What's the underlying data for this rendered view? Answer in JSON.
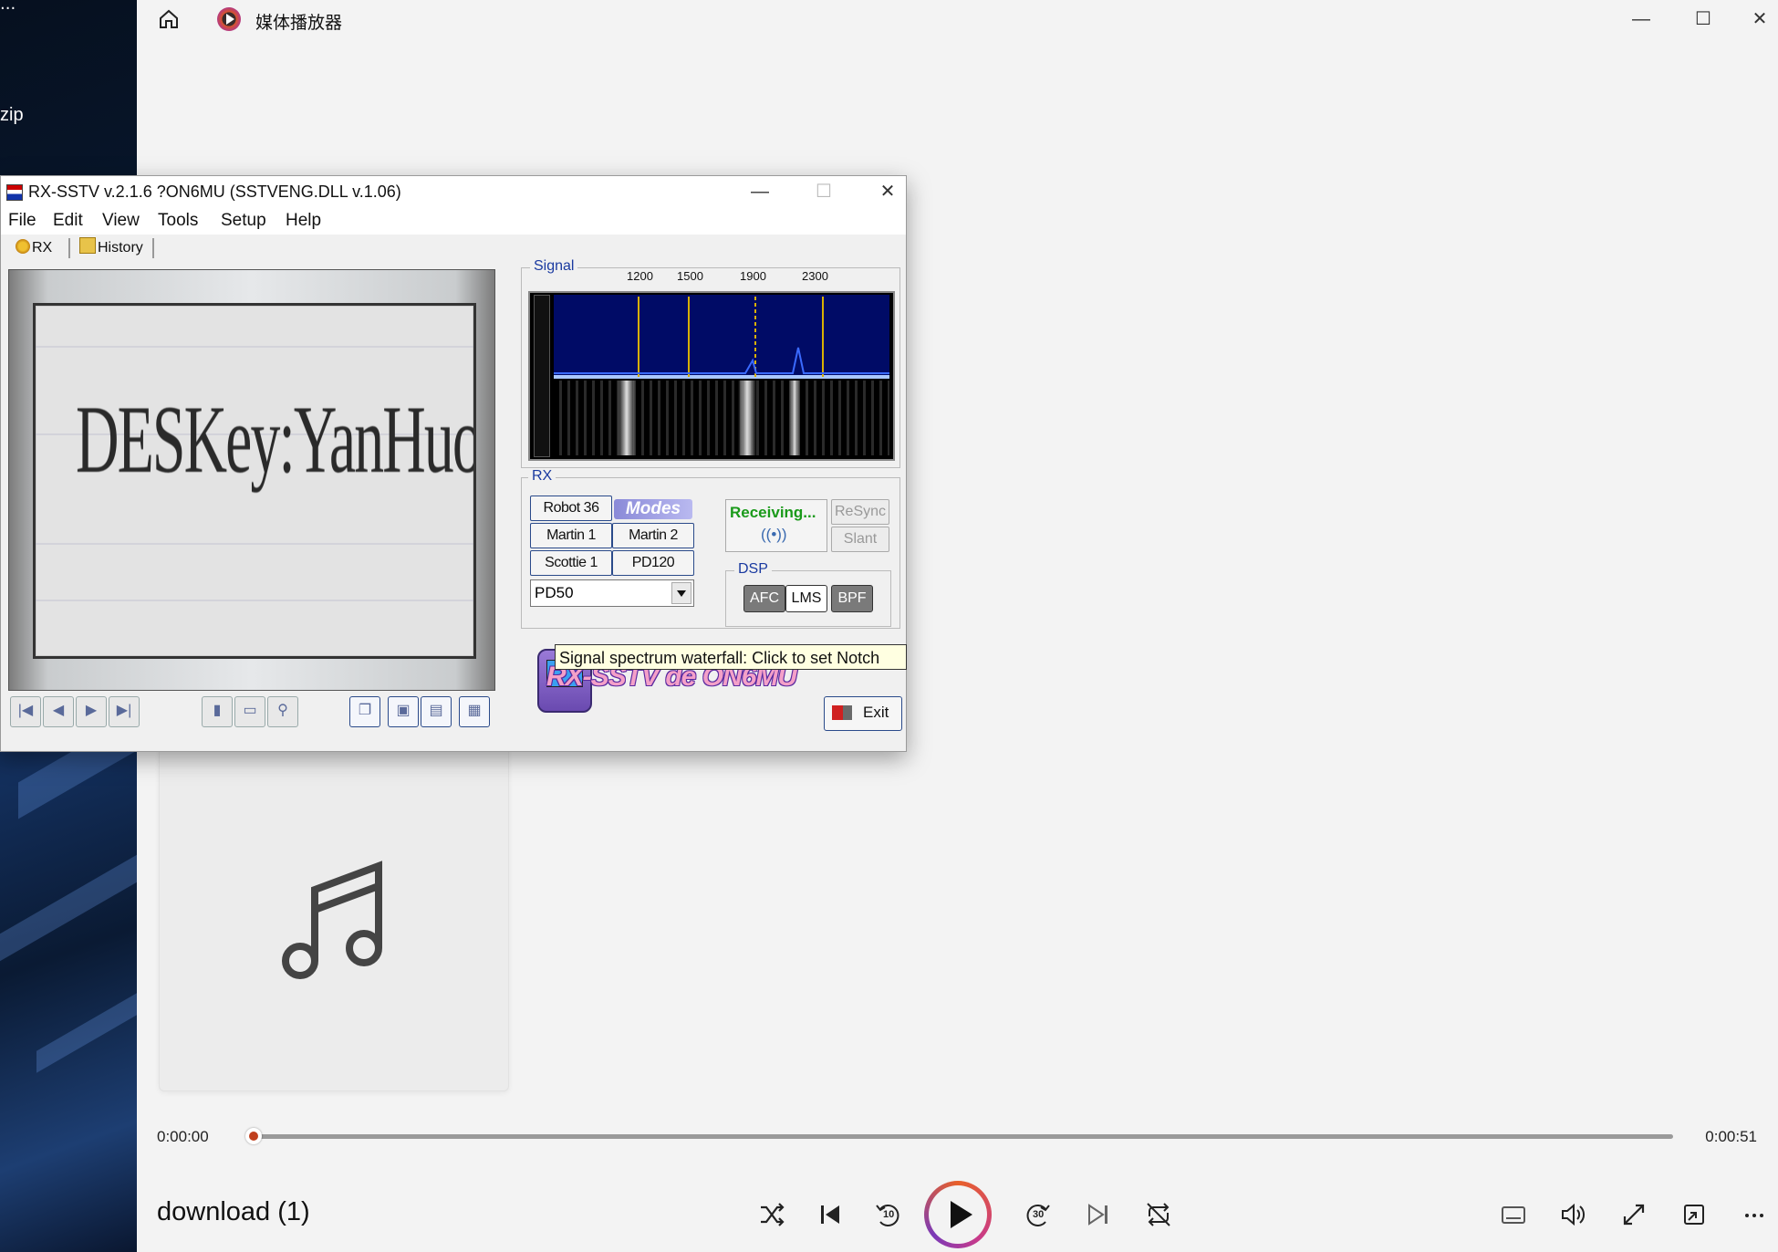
{
  "desktop": {
    "partial_label": "zip",
    "partial_dots": "..."
  },
  "media_player": {
    "title": "媒体播放器",
    "window_controls": {
      "minimize": "—",
      "maximize": "☐",
      "close": "✕"
    },
    "time_elapsed": "0:00:00",
    "time_total": "0:00:51",
    "progress_fraction": 0.0,
    "track_title": "download (1)",
    "skip_back_seconds": "10",
    "skip_forward_seconds": "30",
    "accent_colors": [
      "#e8602a",
      "#c83a8a",
      "#7a3ab8"
    ]
  },
  "rx_sstv": {
    "title": "RX-SSTV v.2.1.6 ?ON6MU (SSTVENG.DLL v.1.06)",
    "window_controls": {
      "minimize": "—",
      "maximize": "☐",
      "close": "✕"
    },
    "menu": [
      "File",
      "Edit",
      "View",
      "Tools",
      "Setup",
      "Help"
    ],
    "tabs": [
      {
        "label": "RX",
        "icon": "gear-icon"
      },
      {
        "label": "History",
        "icon": "folder-icon"
      }
    ],
    "image_text": "DESKey:YanHuoLG",
    "signal": {
      "label": "Signal",
      "frequency_ticks": [
        "1200",
        "1500",
        "1900",
        "2300"
      ]
    },
    "rx_group": {
      "label": "RX",
      "modes": [
        "Robot 36",
        "Martin 1",
        "Martin 2",
        "Scottie 1",
        "PD120"
      ],
      "modes_logo": "Modes",
      "selected_mode": "PD50",
      "status": "Receiving...",
      "resync_label": "ReSync",
      "slant_label": "Slant"
    },
    "dsp": {
      "label": "DSP",
      "buttons": [
        {
          "label": "AFC",
          "active": true
        },
        {
          "label": "LMS",
          "active": false
        },
        {
          "label": "BPF",
          "active": true
        }
      ]
    },
    "logo_text": "RX-SSTV de ON6MU",
    "exit_label": "Exit",
    "tooltip": "Signal spectrum waterfall: Click to set Notch"
  }
}
